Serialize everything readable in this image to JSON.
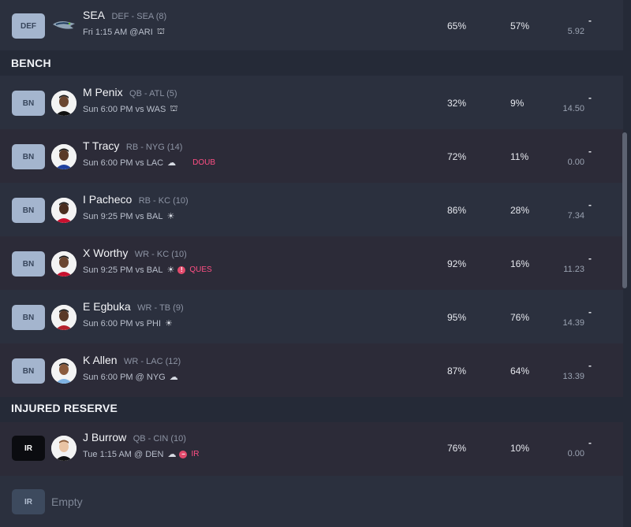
{
  "def_row": {
    "slot": "DEF",
    "team_logo_icon": "seahawks-logo-icon",
    "name": "SEA",
    "meta": "DEF - SEA (8)",
    "game": "Fri 1:15 AM @ARI",
    "weather_icon": "stadium-dome-icon",
    "start_pct": "65%",
    "own_pct": "57%",
    "proj_dash": "-",
    "proj": "5.92"
  },
  "bench_label": "BENCH",
  "bench": [
    {
      "slot": "BN",
      "name": "M Penix",
      "meta": "QB - ATL (5)",
      "game": "Sun 6:00 PM vs WAS",
      "weather": "⛫",
      "status": "",
      "start_pct": "32%",
      "own_pct": "9%",
      "proj_dash": "-",
      "proj": "14.50"
    },
    {
      "slot": "BN",
      "name": "T Tracy",
      "meta": "RB - NYG (14)",
      "game": "Sun 6:00 PM vs LAC",
      "weather": "☁",
      "status": "DOUB",
      "start_pct": "72%",
      "own_pct": "11%",
      "proj_dash": "-",
      "proj": "0.00"
    },
    {
      "slot": "BN",
      "name": "I Pacheco",
      "meta": "RB - KC (10)",
      "game": "Sun 9:25 PM vs BAL",
      "weather": "☀",
      "status": "",
      "start_pct": "86%",
      "own_pct": "28%",
      "proj_dash": "-",
      "proj": "7.34"
    },
    {
      "slot": "BN",
      "name": "X Worthy",
      "meta": "WR - KC (10)",
      "game": "Sun 9:25 PM vs BAL",
      "weather": "☀",
      "status": "QUES",
      "start_pct": "92%",
      "own_pct": "16%",
      "proj_dash": "-",
      "proj": "11.23"
    },
    {
      "slot": "BN",
      "name": "E Egbuka",
      "meta": "WR - TB (9)",
      "game": "Sun 6:00 PM vs PHI",
      "weather": "☀",
      "status": "",
      "start_pct": "95%",
      "own_pct": "76%",
      "proj_dash": "-",
      "proj": "14.39"
    },
    {
      "slot": "BN",
      "name": "K Allen",
      "meta": "WR - LAC (12)",
      "game": "Sun 6:00 PM @ NYG",
      "weather": "☁",
      "status": "",
      "start_pct": "87%",
      "own_pct": "64%",
      "proj_dash": "-",
      "proj": "13.39"
    }
  ],
  "ir_label": "INJURED RESERVE",
  "ir": {
    "slot": "IR",
    "name": "J Burrow",
    "meta": "QB - CIN (10)",
    "game": "Tue 1:15 AM @ DEN",
    "weather": "☁",
    "status": "IR",
    "start_pct": "76%",
    "own_pct": "10%",
    "proj_dash": "-",
    "proj": "0.00"
  },
  "ir_empty": {
    "slot": "IR",
    "label": "Empty"
  },
  "colors": {
    "status_red": "#ff4f84",
    "bench_slot": "#a4b5ce",
    "ir_slot": "#0b0c10"
  }
}
